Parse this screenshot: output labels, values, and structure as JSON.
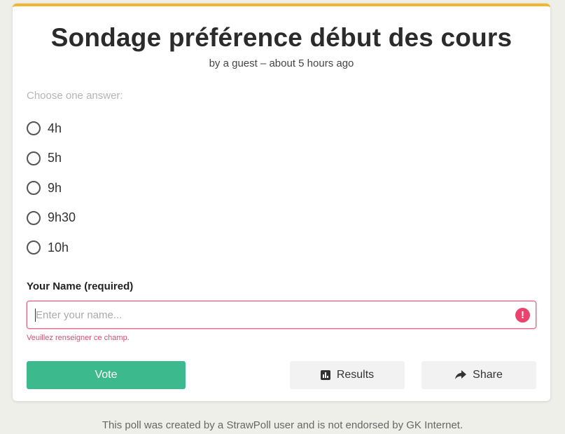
{
  "poll": {
    "title": "Sondage préférence début des cours",
    "byline": "by a guest – about 5 hours ago",
    "prompt": "Choose one answer:",
    "options": [
      {
        "label": "4h"
      },
      {
        "label": "5h"
      },
      {
        "label": "9h"
      },
      {
        "label": "9h30"
      },
      {
        "label": "10h"
      }
    ]
  },
  "name_field": {
    "label": "Your Name (required)",
    "placeholder": "Enter your name...",
    "value": "",
    "error": "Veuillez renseigner ce champ.",
    "alert_icon_glyph": "!"
  },
  "buttons": {
    "vote": "Vote",
    "results": "Results",
    "share": "Share"
  },
  "footer": "This poll was created by a StrawPoll user and is not endorsed by GK Internet.",
  "colors": {
    "accent_top": "#f2b632",
    "vote_green": "#3dba8d",
    "error_pink": "#e8446d",
    "page_bg": "#efefea"
  }
}
